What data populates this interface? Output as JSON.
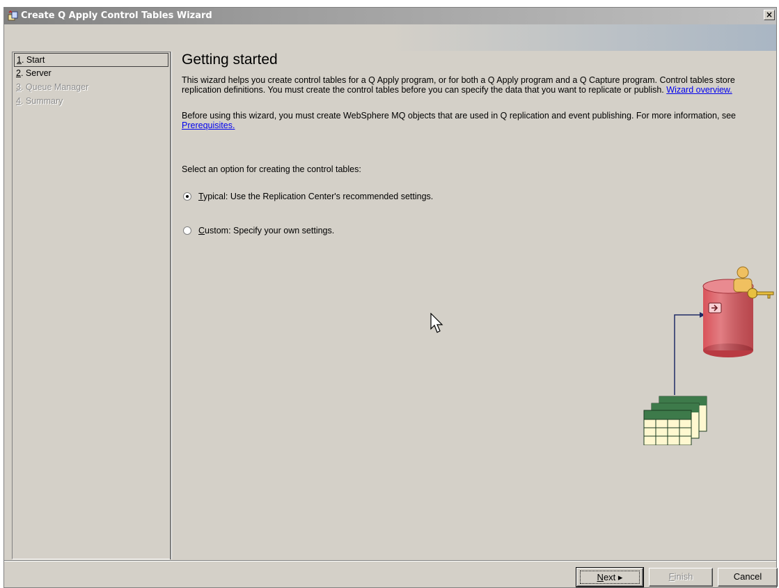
{
  "window": {
    "title": "Create Q Apply Control Tables Wizard",
    "close_label": "×",
    "icon": "wizard-app-icon"
  },
  "steps": [
    {
      "num": "1",
      "label": ". Start",
      "state": "active"
    },
    {
      "num": "2",
      "label": ". Server",
      "state": "enabled"
    },
    {
      "num": "3",
      "label": ". Queue Manager",
      "state": "disabled"
    },
    {
      "num": "4",
      "label": ". Summary",
      "state": "disabled"
    }
  ],
  "content": {
    "heading": "Getting started",
    "intro": "This wizard helps you create control tables for a Q Apply program, or for both a Q Apply program and a Q Capture program. Control tables store replication definitions. You must create the control tables before you can specify the data that you want to replicate or publish.",
    "intro_link": "Wizard overview.",
    "prereq_text": "Before using this wizard, you must create WebSphere MQ objects that are used in Q replication and event publishing. For more information, see",
    "prereq_link": "Prerequisites.",
    "select_prompt": "Select an option for creating the control tables:",
    "options": [
      {
        "mnemonic": "T",
        "rest": "ypical: Use the Replication Center's recommended settings.",
        "checked": true
      },
      {
        "mnemonic": "C",
        "rest": "ustom: Specify your own settings.",
        "checked": false
      }
    ]
  },
  "buttons": {
    "next_mnemonic": "N",
    "next_rest": "ext",
    "next_arrow": "▸",
    "finish_mnemonic": "F",
    "finish_rest": "inish",
    "cancel": "Cancel"
  },
  "colors": {
    "dialog_bg": "#d4d0c8",
    "link": "#0000ee",
    "database": "#d9535a",
    "table_stack": "#3d7a4a"
  },
  "illustration": {
    "icons": [
      "database-icon",
      "user-icon",
      "key-icon",
      "table-stack-icon"
    ]
  }
}
